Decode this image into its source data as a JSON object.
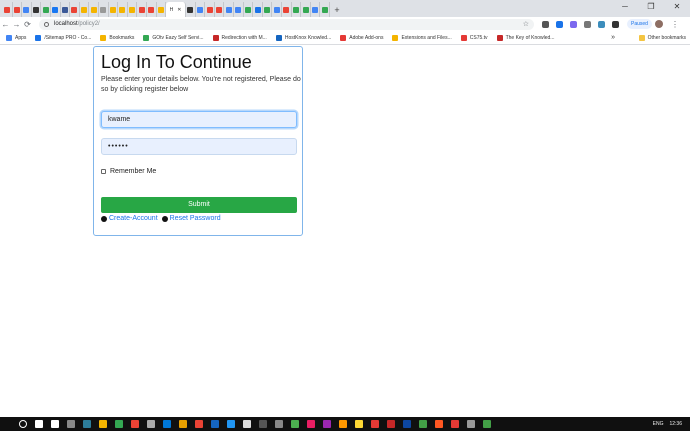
{
  "browser": {
    "tabs": [
      "M",
      "Y",
      "G",
      "",
      "Y",
      "f",
      "f",
      "Y",
      "",
      "L",
      "g",
      "",
      "",
      "",
      "",
      "c",
      "o",
      "H",
      "G",
      "A",
      "A",
      "",
      "P",
      "",
      "",
      "",
      "",
      "Y",
      "",
      "V",
      "G",
      "G"
    ],
    "active_tab_label": "H",
    "active_tab_close": "✕",
    "new_tab": "+",
    "window_controls": [
      "─",
      "❐",
      "✕"
    ],
    "url_host": "localhost",
    "url_path": "/policy2/",
    "paused_label": "Paused",
    "nav": {
      "back": "←",
      "forward": "→",
      "reload": "⟳"
    },
    "star": "☆",
    "menu": "⋮"
  },
  "bookmarks": {
    "items": [
      "Apps",
      "/Sitemap PRO - Co...",
      "Bookmarks",
      "GOtv Eazy Self Servi...",
      "Redirection with M...",
      "HostKnox Knowled...",
      "Adobe Add-ons",
      "Extensions and Files...",
      "CS75.tv",
      "The Key of Knowled..."
    ],
    "overflow": "»",
    "other": "Other bookmarks"
  },
  "login": {
    "title": "Log In To Continue",
    "subtitle": "Please enter your details below. You're not registered, Please do so by clicking register below",
    "username_value": "kwame",
    "password_value": "••••••",
    "remember_label": "Remember Me",
    "submit_label": "Submit",
    "create_account": "Create-Account",
    "reset_password": "Reset Password"
  },
  "taskbar": {
    "language": "ENG",
    "time": "12:36"
  },
  "colors": {
    "submit": "#28a745",
    "link": "#1a73e8",
    "card_border": "#80b5ea",
    "input_bg": "#e8f0fe"
  }
}
